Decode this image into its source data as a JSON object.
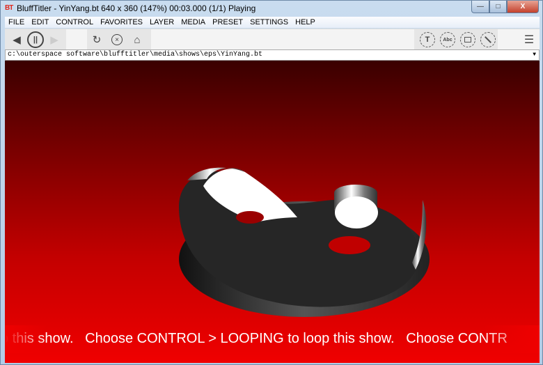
{
  "window": {
    "logo": "BT",
    "title": "BluffTitler - YinYang.bt 640 x 360 (147%) 00:03.000 (1/1) Playing",
    "minimize": "—",
    "maximize": "□",
    "close": "X"
  },
  "menu": [
    "FILE",
    "EDIT",
    "CONTROL",
    "FAVORITES",
    "LAYER",
    "MEDIA",
    "PRESET",
    "SETTINGS",
    "HELP"
  ],
  "toolbar": {
    "back": "arrow-left-icon",
    "pause": "pause-icon",
    "forward": "arrow-right-icon",
    "reload": "reload-icon",
    "stop": "stop-icon",
    "home": "home-icon",
    "text_label": "T",
    "abc_label": "Abc",
    "image": "image-icon",
    "draw": "pen-icon",
    "menu": "hamburger-icon"
  },
  "path": {
    "value": "c:\\outerspace software\\blufftitler\\media\\shows\\eps\\YinYang.bt"
  },
  "viewport": {
    "scroll_text": "o this show.   Choose CONTROL > LOOPING to loop this show.   Choose CONTR"
  }
}
